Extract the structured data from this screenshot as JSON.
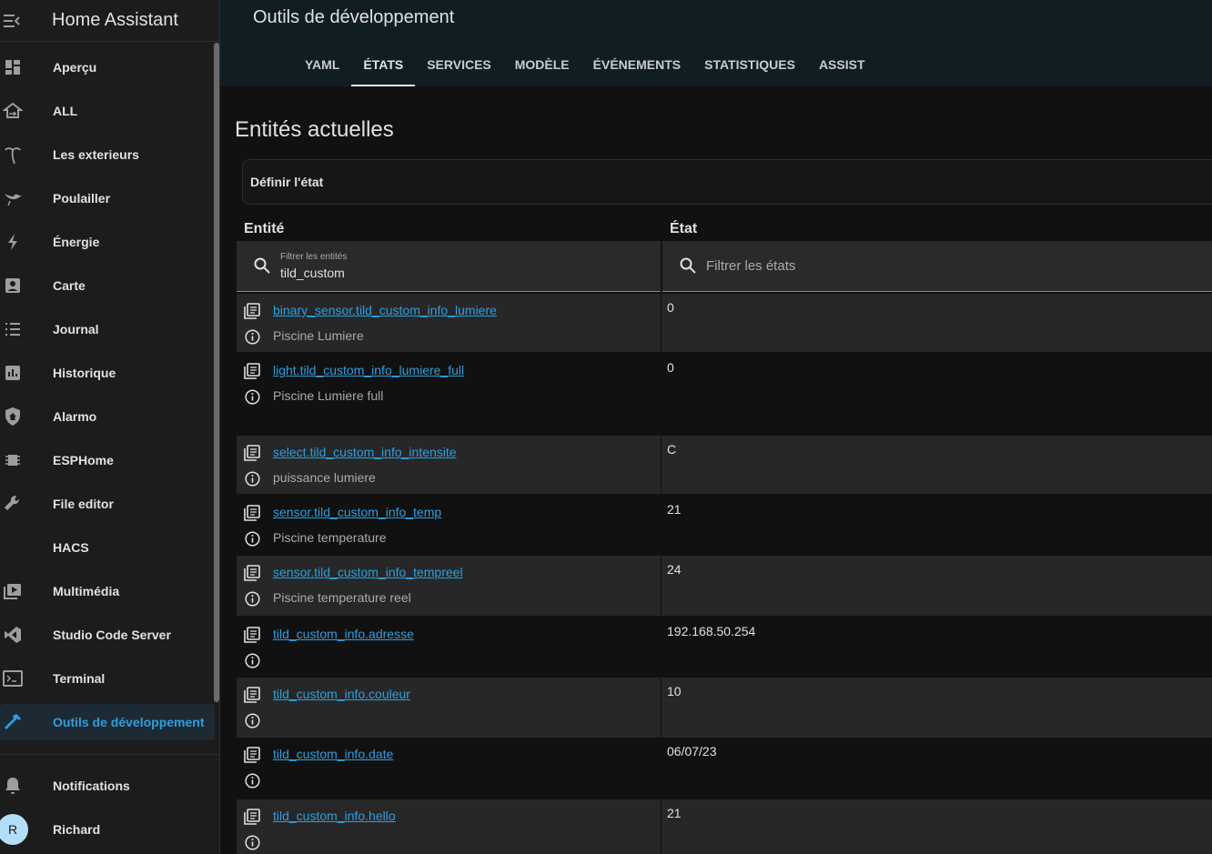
{
  "app": {
    "title": "Home Assistant"
  },
  "sidebar": {
    "items": [
      {
        "label": "Aperçu",
        "icon": "dashboard-icon"
      },
      {
        "label": "ALL",
        "icon": "home-switch-icon"
      },
      {
        "label": "Les exterieurs",
        "icon": "palm-tree-icon"
      },
      {
        "label": "Poulailler",
        "icon": "bird-icon"
      },
      {
        "label": "Énergie",
        "icon": "lightning-icon"
      },
      {
        "label": "Carte",
        "icon": "account-box-icon"
      },
      {
        "label": "Journal",
        "icon": "list-icon"
      },
      {
        "label": "Historique",
        "icon": "chart-box-icon"
      },
      {
        "label": "Alarmo",
        "icon": "shield-home-icon"
      },
      {
        "label": "ESPHome",
        "icon": "chip-icon"
      },
      {
        "label": "File editor",
        "icon": "wrench-icon"
      },
      {
        "label": "HACS",
        "icon": ""
      },
      {
        "label": "Multimédia",
        "icon": "media-play-icon"
      },
      {
        "label": "Studio Code Server",
        "icon": "vscode-icon"
      },
      {
        "label": "Terminal",
        "icon": "console-icon"
      },
      {
        "label": "Outils de développement",
        "icon": "hammer-icon"
      }
    ],
    "notifications": "Notifications",
    "user": {
      "name": "Richard",
      "initial": "R"
    }
  },
  "header": {
    "title": "Outils de développement",
    "tabs": [
      {
        "label": "YAML"
      },
      {
        "label": "ÉTATS"
      },
      {
        "label": "SERVICES"
      },
      {
        "label": "MODÈLE"
      },
      {
        "label": "ÉVÉNEMENTS"
      },
      {
        "label": "STATISTIQUES"
      },
      {
        "label": "ASSIST"
      }
    ],
    "active_tab": "ÉTATS"
  },
  "main": {
    "heading": "Entités actuelles",
    "set_state_label": "Définir l'état",
    "columns": {
      "entity": "Entité",
      "state": "État"
    },
    "entity_filter": {
      "label": "Filtrer les entités",
      "value": "tild_custom"
    },
    "state_filter": {
      "placeholder": "Filtrer les états"
    },
    "rows": [
      {
        "entity_id": "binary_sensor.tild_custom_info_lumiere",
        "friendly_name": "Piscine Lumiere",
        "state": "0"
      },
      {
        "entity_id": "light.tild_custom_info_lumiere_full",
        "friendly_name": "Piscine Lumiere full",
        "state": "0"
      },
      {
        "entity_id": "select.tild_custom_info_intensite",
        "friendly_name": "puissance lumiere",
        "state": "C"
      },
      {
        "entity_id": "sensor.tild_custom_info_temp",
        "friendly_name": "Piscine temperature",
        "state": "21"
      },
      {
        "entity_id": "sensor.tild_custom_info_tempreel",
        "friendly_name": "Piscine temperature reel",
        "state": "24"
      },
      {
        "entity_id": "tild_custom_info.adresse",
        "friendly_name": "",
        "state": "192.168.50.254"
      },
      {
        "entity_id": "tild_custom_info.couleur",
        "friendly_name": "",
        "state": "10"
      },
      {
        "entity_id": "tild_custom_info.date",
        "friendly_name": "",
        "state": "06/07/23"
      },
      {
        "entity_id": "tild_custom_info.hello",
        "friendly_name": "",
        "state": "21"
      }
    ]
  }
}
